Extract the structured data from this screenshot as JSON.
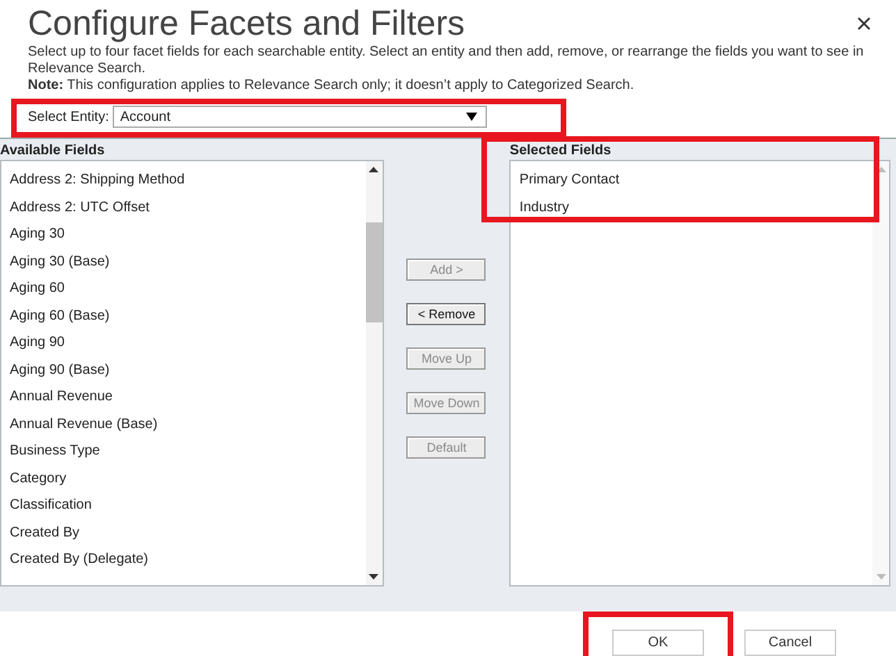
{
  "dialog": {
    "title": "Configure Facets and Filters",
    "description": "Select up to four facet fields for each searchable entity. Select an entity and then add, remove, or rearrange the fields you want to see in Relevance Search.",
    "note": "**Note:** This configuration applies to Relevance Search only; it doesn’t apply to Categorized Search."
  },
  "entity": {
    "label": "Select Entity:",
    "value": "Account"
  },
  "available": {
    "label": "Available Fields",
    "items": [
      {
        "label": "Address 2: Shipping Method",
        "selected": false
      },
      {
        "label": "Address 2: UTC Offset",
        "selected": false
      },
      {
        "label": "Aging 30",
        "selected": false
      },
      {
        "label": "Aging 30 (Base)",
        "selected": false
      },
      {
        "label": "Aging 60",
        "selected": false
      },
      {
        "label": "Aging 60 (Base)",
        "selected": false
      },
      {
        "label": "Aging 90",
        "selected": false
      },
      {
        "label": "Aging 90 (Base)",
        "selected": false
      },
      {
        "label": "Annual Revenue",
        "selected": false
      },
      {
        "label": "Annual Revenue (Base)",
        "selected": false
      },
      {
        "label": "Business Type",
        "selected": false
      },
      {
        "label": "Category",
        "selected": false
      },
      {
        "label": "Classification",
        "selected": false
      },
      {
        "label": "Created By",
        "selected": false
      },
      {
        "label": "Created By (Delegate)",
        "selected": false
      }
    ]
  },
  "actions": [
    {
      "label": "Add >",
      "disabled": true
    },
    {
      "label": "< Remove",
      "disabled": false
    },
    {
      "label": "Move Up",
      "disabled": true
    },
    {
      "label": "Move Down",
      "disabled": true
    },
    {
      "label": "Default",
      "disabled": true
    }
  ],
  "selected": {
    "label": "Selected Fields",
    "items": [
      {
        "label": "Primary Contact",
        "selected": false
      },
      {
        "label": "Industry",
        "selected": false
      }
    ]
  },
  "buttons": [
    {
      "label": "OK",
      "highlighted": true
    },
    {
      "label": "Cancel",
      "highlighted": false
    }
  ],
  "highlights": {
    "entity": true,
    "selected_fields": true
  }
}
